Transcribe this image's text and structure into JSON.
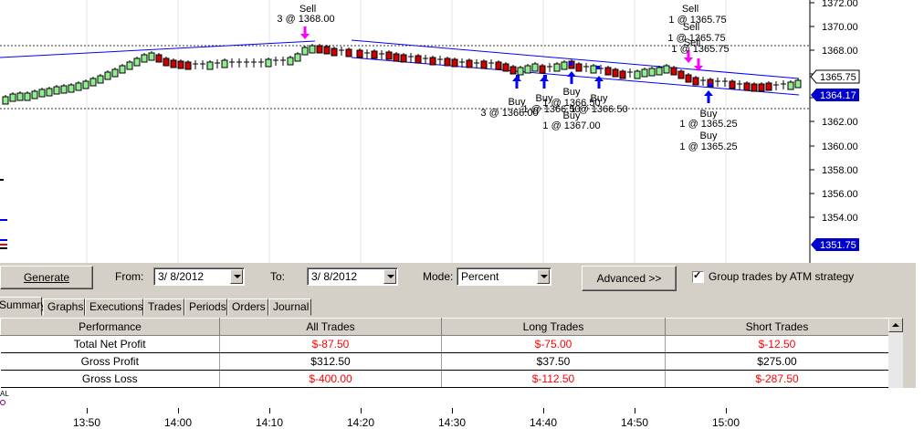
{
  "chart": {
    "price_labels": [
      "1372.00",
      "1370.00",
      "1368.00",
      "1366.00",
      "1364.00",
      "1362.00",
      "1360.00",
      "1358.00",
      "1356.00",
      "1354.00"
    ],
    "last_price": "1365.75",
    "bid_price": "1364.17",
    "bottom_price": "1351.75",
    "annotations": [
      {
        "text": "Sell"
      },
      {
        "text": "3 @ 1368.00"
      },
      {
        "text": "Buy"
      },
      {
        "text": "3 @ 1366.00"
      },
      {
        "text": "Buy"
      },
      {
        "text": "1 @ 1366.50"
      },
      {
        "text": "Buy"
      },
      {
        "text": "1 @ 1367.00"
      },
      {
        "text": "Buy"
      },
      {
        "text": "1 @ 1366.50"
      },
      {
        "text": "Buy"
      },
      {
        "text": "1 @ 1367.00"
      },
      {
        "text": "Sell"
      },
      {
        "text": "1 @ 1365.75"
      },
      {
        "text": "Sell"
      },
      {
        "text": "1 @ 1365.75"
      },
      {
        "text": "Sell"
      },
      {
        "text": "1 @ 1365.75"
      },
      {
        "text": "Buy"
      },
      {
        "text": "1 @ 1365.25"
      },
      {
        "text": "Buy"
      },
      {
        "text": "1 @ 1365.25"
      }
    ],
    "time_labels": [
      "13:50",
      "14:00",
      "14:10",
      "14:20",
      "14:30",
      "14:40",
      "14:50",
      "15:00"
    ],
    "bottom_left_label": "AL",
    "colors": {
      "up": "#90ee90",
      "down": "#cc0000",
      "sell": "#ff00ff",
      "buy": "#0000ff",
      "channel": "#0000ff"
    }
  },
  "controls": {
    "generate": "Generate",
    "from_label": "From:",
    "from_value": "3/ 8/2012",
    "to_label": "To:",
    "to_value": "3/ 8/2012",
    "mode_label": "Mode:",
    "mode_value": "Percent",
    "advanced": "Advanced >>",
    "group_label": "Group trades by ATM strategy"
  },
  "tabs": [
    "Summary",
    "Graphs",
    "Executions",
    "Trades",
    "Periods",
    "Orders",
    "Journal"
  ],
  "table": {
    "headers": [
      "Performance",
      "All Trades",
      "Long Trades",
      "Short Trades"
    ],
    "rows": [
      [
        "Total Net Profit",
        "$-87.50",
        "$-75.00",
        "$-12.50"
      ],
      [
        "Gross Profit",
        "$312.50",
        "$37.50",
        "$275.00"
      ],
      [
        "Gross Loss",
        "$-400.00",
        "$-112.50",
        "$-287.50"
      ]
    ]
  }
}
